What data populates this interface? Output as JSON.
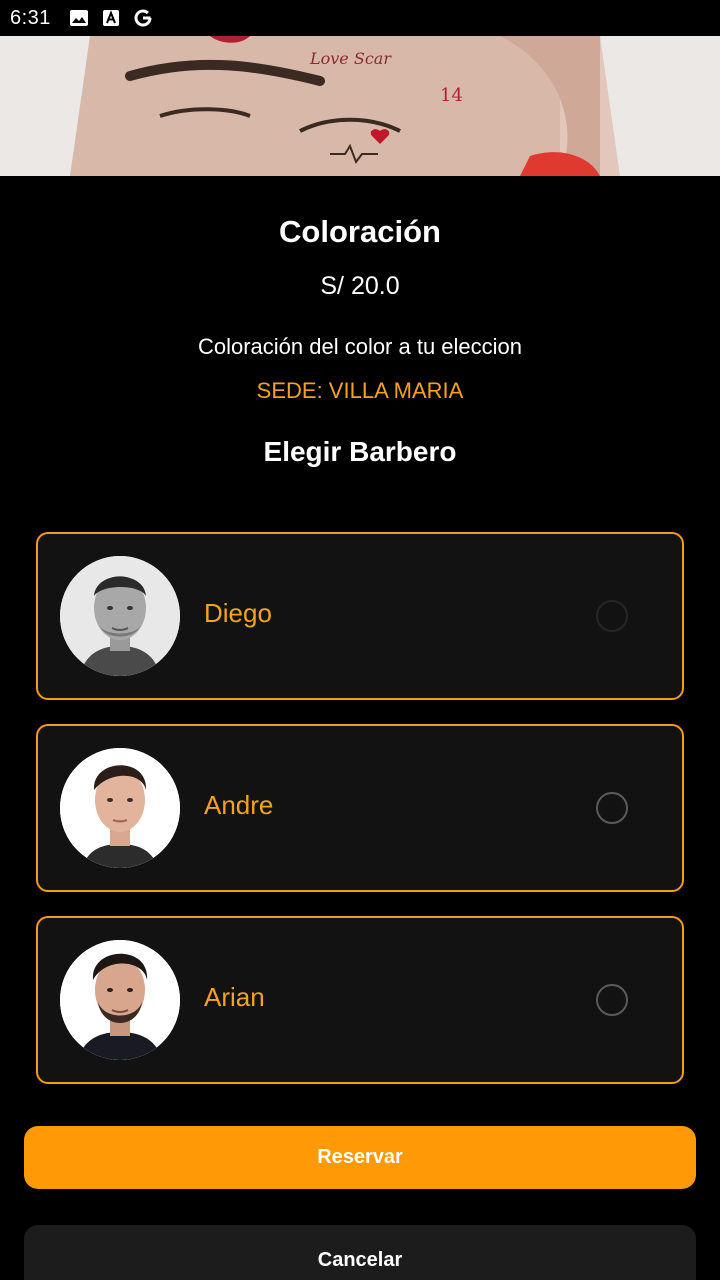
{
  "status_bar": {
    "time": "6:31",
    "icons": [
      "image-icon",
      "text-icon",
      "google-icon"
    ]
  },
  "service": {
    "title": "Coloración",
    "price": "S/ 20.0",
    "description": "Coloración del color a tu eleccion",
    "sede": "SEDE: VILLA MARIA"
  },
  "barber_section": {
    "title": "Elegir Barbero",
    "barbers": [
      {
        "name": "Diego"
      },
      {
        "name": "Andre"
      },
      {
        "name": "Arian"
      }
    ]
  },
  "actions": {
    "reserve_label": "Reservar",
    "cancel_label": "Cancelar"
  },
  "colors": {
    "accent": "#f5a21e",
    "button": "#ff9a06",
    "background": "#000000",
    "card": "#121212"
  }
}
